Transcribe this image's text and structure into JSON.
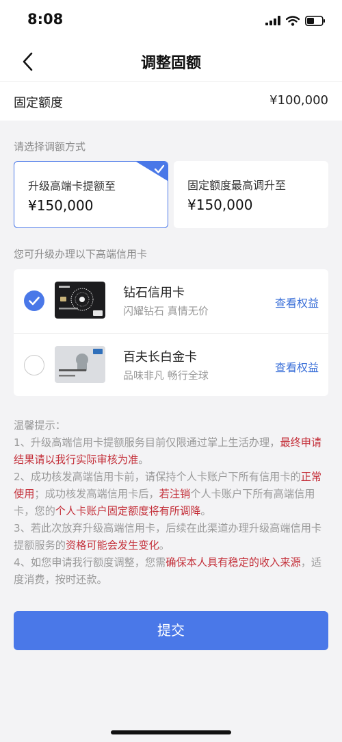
{
  "status_bar": {
    "time": "8:08"
  },
  "nav": {
    "title": "调整固额"
  },
  "quota": {
    "label": "固定额度",
    "value": "¥100,000"
  },
  "select_section_label": "请选择调额方式",
  "options": [
    {
      "title": "升级高端卡提额至",
      "amount": "¥150,000",
      "selected": true
    },
    {
      "title": "固定额度最高调升至",
      "amount": "¥150,000",
      "selected": false
    }
  ],
  "cards_section_label": "您可升级办理以下高端信用卡",
  "cards": [
    {
      "name": "钻石信用卡",
      "slogan": "闪耀钻石 真情无价",
      "link": "查看权益",
      "checked": true
    },
    {
      "name": "百夫长白金卡",
      "slogan": "品味非凡 畅行全球",
      "link": "查看权益",
      "checked": false
    }
  ],
  "notes": {
    "title": "温馨提示：",
    "items": [
      [
        {
          "text": "1、升级高端信用卡提额服务目前仅限通过掌上生活办理，",
          "hl": false
        },
        {
          "text": "最终申请结果请以我行实际审核为准",
          "hl": true
        },
        {
          "text": "。",
          "hl": false
        }
      ],
      [
        {
          "text": "2、成功核发高端信用卡前，请保持个人卡账户下所有信用卡的",
          "hl": false
        },
        {
          "text": "正常使用",
          "hl": true
        },
        {
          "text": "；成功核发高端信用卡后，",
          "hl": false
        },
        {
          "text": "若注销",
          "hl": true
        },
        {
          "text": "个人卡账户下所有高端信用卡，您的",
          "hl": false
        },
        {
          "text": "个人卡账户固定额度将有所调降",
          "hl": true
        },
        {
          "text": "。",
          "hl": false
        }
      ],
      [
        {
          "text": "3、若此次放弃升级高端信用卡，后续在此渠道办理升级高端信用卡提额服务的",
          "hl": false
        },
        {
          "text": "资格可能会发生变化",
          "hl": true
        },
        {
          "text": "。",
          "hl": false
        }
      ],
      [
        {
          "text": "4、如您申请我行额度调整，您需",
          "hl": false
        },
        {
          "text": "确保本人具有稳定的收入来源",
          "hl": true
        },
        {
          "text": "，适度消费，按时还款。",
          "hl": false
        }
      ]
    ]
  },
  "submit_label": "提交",
  "colors": {
    "accent": "#4a78e8",
    "link": "#3a6fd8",
    "highlight": "#c4303a",
    "background": "#f3f3f5"
  }
}
